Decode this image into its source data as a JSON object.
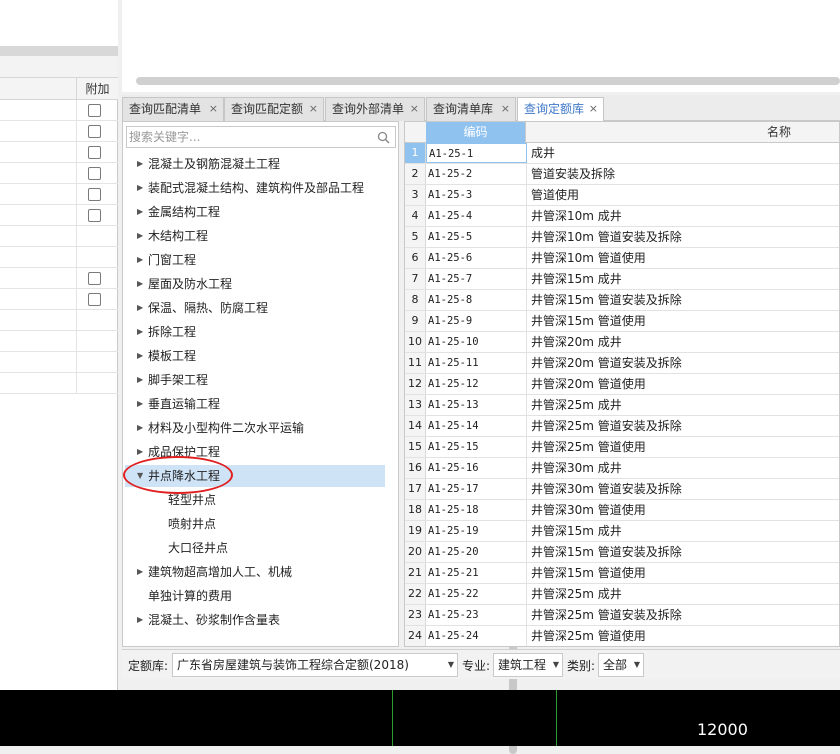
{
  "left_panel": {
    "column_header": "附加",
    "rows": [
      {
        "checkbox": true
      },
      {
        "checkbox": true
      },
      {
        "checkbox": true
      },
      {
        "checkbox": true
      },
      {
        "checkbox": true
      },
      {
        "checkbox": true
      },
      {
        "checkbox": false
      },
      {
        "checkbox": false
      },
      {
        "checkbox": true
      },
      {
        "checkbox": true
      },
      {
        "checkbox": false
      },
      {
        "checkbox": false
      },
      {
        "checkbox": false
      },
      {
        "checkbox": false
      }
    ]
  },
  "tabs": [
    {
      "label": "查询匹配清单",
      "close": "×"
    },
    {
      "label": "查询匹配定额",
      "close": "×"
    },
    {
      "label": "查询外部清单",
      "close": "×"
    },
    {
      "label": "查询清单库",
      "close": "×"
    },
    {
      "label": "查询定额库",
      "close": "×",
      "active": true
    }
  ],
  "search": {
    "placeholder": "搜索关键字...",
    "icon": "search-icon"
  },
  "tree": [
    {
      "label": "混凝土及钢筋混凝土工程",
      "expandable": true
    },
    {
      "label": "装配式混凝土结构、建筑构件及部品工程",
      "expandable": true
    },
    {
      "label": "金属结构工程",
      "expandable": true
    },
    {
      "label": "木结构工程",
      "expandable": true
    },
    {
      "label": "门窗工程",
      "expandable": true
    },
    {
      "label": "屋面及防水工程",
      "expandable": true
    },
    {
      "label": "保温、隔热、防腐工程",
      "expandable": true
    },
    {
      "label": "拆除工程",
      "expandable": true
    },
    {
      "label": "模板工程",
      "expandable": true
    },
    {
      "label": "脚手架工程",
      "expandable": true
    },
    {
      "label": "垂直运输工程",
      "expandable": true
    },
    {
      "label": "材料及小型构件二次水平运输",
      "expandable": true
    },
    {
      "label": "成品保护工程",
      "expandable": true
    },
    {
      "label": "井点降水工程",
      "expanded": true,
      "selected": true
    },
    {
      "label": "轻型井点",
      "child": true
    },
    {
      "label": "喷射井点",
      "child": true
    },
    {
      "label": "大口径井点",
      "child": true
    },
    {
      "label": "建筑物超高增加人工、机械",
      "expandable": true
    },
    {
      "label": "单独计算的费用",
      "expandable": false
    },
    {
      "label": "混凝土、砂浆制作含量表",
      "expandable": true
    }
  ],
  "grid": {
    "headers": {
      "code": "编码",
      "name": "名称"
    },
    "rows": [
      {
        "num": "1",
        "code": "A1-25-1",
        "name": "成井"
      },
      {
        "num": "2",
        "code": "A1-25-2",
        "name": "管道安装及拆除"
      },
      {
        "num": "3",
        "code": "A1-25-3",
        "name": "管道使用"
      },
      {
        "num": "4",
        "code": "A1-25-4",
        "name": "井管深10m 成井"
      },
      {
        "num": "5",
        "code": "A1-25-5",
        "name": "井管深10m 管道安装及拆除"
      },
      {
        "num": "6",
        "code": "A1-25-6",
        "name": "井管深10m 管道使用"
      },
      {
        "num": "7",
        "code": "A1-25-7",
        "name": "井管深15m 成井"
      },
      {
        "num": "8",
        "code": "A1-25-8",
        "name": "井管深15m 管道安装及拆除"
      },
      {
        "num": "9",
        "code": "A1-25-9",
        "name": "井管深15m 管道使用"
      },
      {
        "num": "10",
        "code": "A1-25-10",
        "name": "井管深20m 成井"
      },
      {
        "num": "11",
        "code": "A1-25-11",
        "name": "井管深20m 管道安装及拆除"
      },
      {
        "num": "12",
        "code": "A1-25-12",
        "name": "井管深20m 管道使用"
      },
      {
        "num": "13",
        "code": "A1-25-13",
        "name": "井管深25m 成井"
      },
      {
        "num": "14",
        "code": "A1-25-14",
        "name": "井管深25m 管道安装及拆除"
      },
      {
        "num": "15",
        "code": "A1-25-15",
        "name": "井管深25m 管道使用"
      },
      {
        "num": "16",
        "code": "A1-25-16",
        "name": "井管深30m 成井"
      },
      {
        "num": "17",
        "code": "A1-25-17",
        "name": "井管深30m 管道安装及拆除"
      },
      {
        "num": "18",
        "code": "A1-25-18",
        "name": "井管深30m 管道使用"
      },
      {
        "num": "19",
        "code": "A1-25-19",
        "name": "井管深15m 成井"
      },
      {
        "num": "20",
        "code": "A1-25-20",
        "name": "井管深15m 管道安装及拆除"
      },
      {
        "num": "21",
        "code": "A1-25-21",
        "name": "井管深15m 管道使用"
      },
      {
        "num": "22",
        "code": "A1-25-22",
        "name": "井管深25m 成井"
      },
      {
        "num": "23",
        "code": "A1-25-23",
        "name": "井管深25m 管道安装及拆除"
      },
      {
        "num": "24",
        "code": "A1-25-24",
        "name": "井管深25m 管道使用"
      }
    ]
  },
  "filter_bar": {
    "library_label": "定额库:",
    "library_value": "广东省房屋建筑与装饰工程综合定额(2018)",
    "specialty_label": "专业:",
    "specialty_value": "建筑工程",
    "category_label": "类别:",
    "category_value": "全部"
  },
  "canvas": {
    "coordinate": "12000"
  },
  "colors": {
    "accent": "#8fc2ef",
    "tab_active_text": "#3f78c8",
    "annotation": "#e02020"
  }
}
